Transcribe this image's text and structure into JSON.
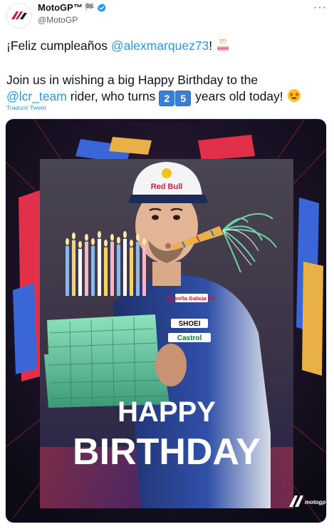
{
  "account": {
    "display_name": "MotoGP™",
    "handle": "@MotoGP",
    "flag_emoji": "🏁"
  },
  "tweet": {
    "line1_prefix": "¡Feliz cumpleaños ",
    "line1_mention": "@alexmarquez73",
    "line1_suffix": "!",
    "line2_prefix": "Join us in wishing a big Happy Birthday to the",
    "line3_mention": "@lcr_team",
    "line3_middle": " rider, who turns ",
    "age_digit_1": "2",
    "age_digit_2": "5",
    "line3_suffix": " years old today! ",
    "translate_label": "Traducir Tweet"
  },
  "media": {
    "headline_1": "HAPPY",
    "headline_2": "BIRTHDAY",
    "cap_brand": "Red Bull",
    "suit_logos": [
      "Estrella Galicia 0,0",
      "SHOEI",
      "Castrol"
    ],
    "watermark": "motogp"
  },
  "colors": {
    "link": "#1d9bf0",
    "text": "#0f1419",
    "muted": "#536471",
    "verified": "#1d9bf0",
    "poster_bg": "#1a1426",
    "cake_green": "#6fd3a6"
  },
  "icons": {
    "verified": "verified-badge-icon",
    "more": "more-options-icon",
    "cake": "birthday-cake-emoji",
    "star_eyes": "star-struck-emoji"
  }
}
